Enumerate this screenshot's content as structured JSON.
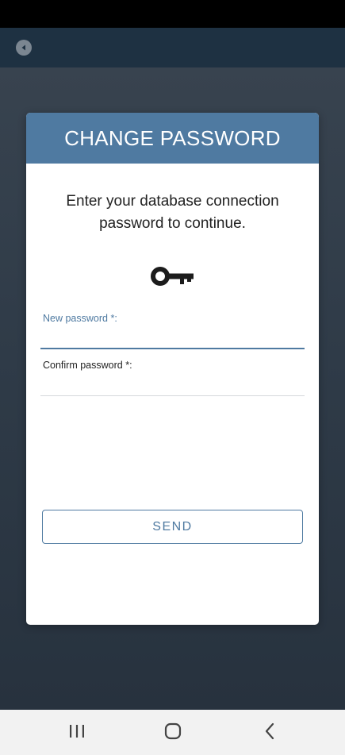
{
  "dialog": {
    "title": "CHANGE PASSWORD",
    "message": "Enter your database connection password to continue.",
    "key_icon": "key-icon"
  },
  "form": {
    "new_password": {
      "label": "New password *:",
      "value": ""
    },
    "confirm_password": {
      "label": "Confirm password *:",
      "value": ""
    },
    "send_label": "SEND"
  },
  "app_bar": {
    "back_icon": "back-circle-icon"
  },
  "nav_bar": {
    "recents_icon": "recents-icon",
    "home_icon": "home-icon",
    "back_icon": "back-chevron-icon"
  },
  "colors": {
    "header": "#4f7aa1",
    "accent": "#4f7aa1",
    "app_bar": "#1e3142",
    "backdrop": "#2f3b47",
    "status_bar": "#000000"
  }
}
